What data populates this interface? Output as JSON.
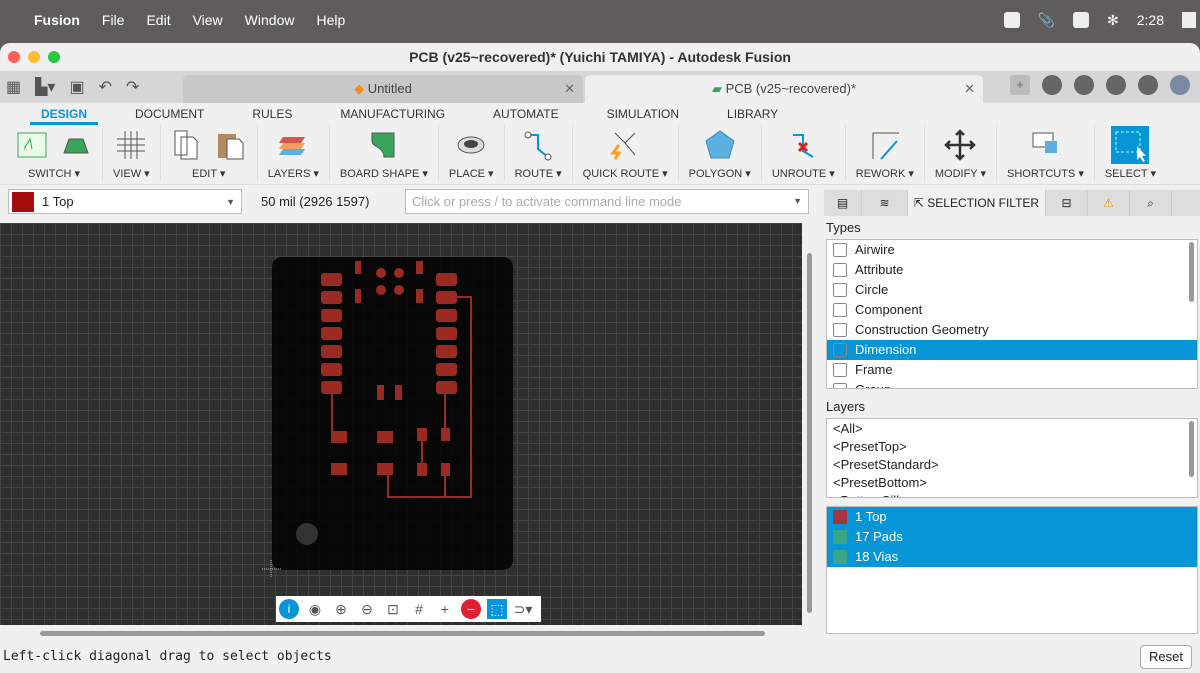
{
  "menubar": {
    "app": "Fusion",
    "items": [
      "File",
      "Edit",
      "View",
      "Window",
      "Help"
    ],
    "clock": "2:28"
  },
  "window": {
    "title": "PCB (v25~recovered)* (Yuichi TAMIYA) - Autodesk Fusion"
  },
  "doc_tabs": [
    {
      "label": "Untitled",
      "active": false
    },
    {
      "label": "PCB (v25~recovered)*",
      "active": true
    }
  ],
  "ribbon_tabs": [
    "DESIGN",
    "DOCUMENT",
    "RULES",
    "MANUFACTURING",
    "AUTOMATE",
    "SIMULATION",
    "LIBRARY"
  ],
  "ribbon_groups": [
    "SWITCH ▾",
    "VIEW ▾",
    "EDIT ▾",
    "LAYERS ▾",
    "BOARD SHAPE ▾",
    "PLACE ▾",
    "ROUTE ▾",
    "QUICK ROUTE ▾",
    "POLYGON ▾",
    "UNROUTE ▾",
    "REWORK ▾",
    "MODIFY ▾",
    "SHORTCUTS ▾",
    "SELECT ▾"
  ],
  "cmdbar": {
    "layer": "1 Top",
    "layer_color": "#a30d0d",
    "coord": "50 mil (2926 1597)",
    "cmd_placeholder": "Click or press / to activate command line mode"
  },
  "status": "Left-click diagonal drag to select objects",
  "panel": {
    "tab": "SELECTION FILTER",
    "types_title": "Types",
    "types": [
      "Airwire",
      "Attribute",
      "Circle",
      "Component",
      "Construction Geometry",
      "Dimension",
      "Frame",
      "Group"
    ],
    "types_selected": "Dimension",
    "layers_title": "Layers",
    "presets": [
      "<All>",
      "<PresetTop>",
      "<PresetStandard>",
      "<PresetBottom>",
      "<BottomSilk>"
    ],
    "layers": [
      {
        "name": "1 Top",
        "color": "#a5343f"
      },
      {
        "name": "17 Pads",
        "color": "#3aa58a"
      },
      {
        "name": "18 Vias",
        "color": "#3aa58a"
      }
    ],
    "reset": "Reset"
  },
  "colors": {
    "accent": "#0696d7",
    "copper": "#9b2a22"
  }
}
